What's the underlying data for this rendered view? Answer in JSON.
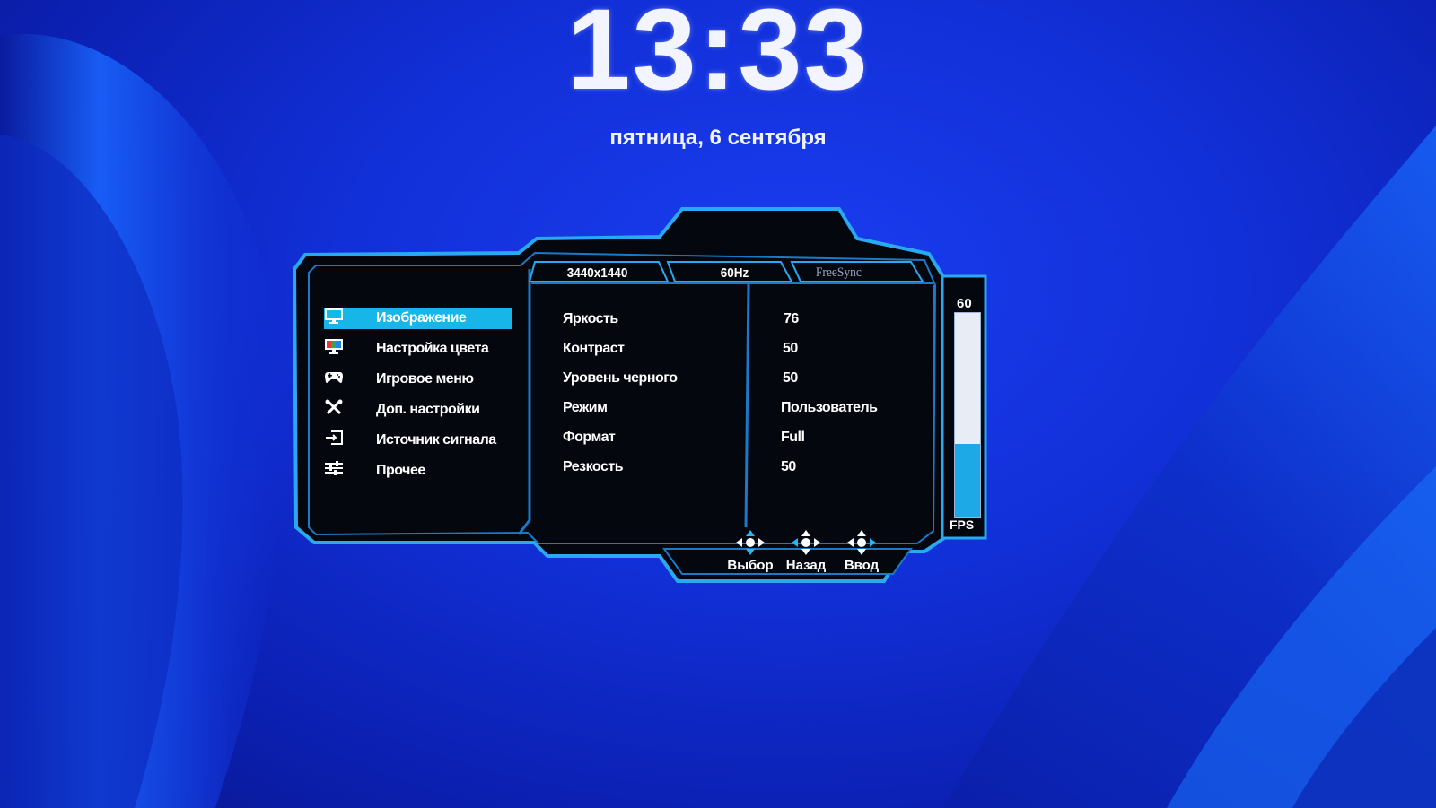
{
  "lockscreen": {
    "time": "13:33",
    "date": "пятница, 6 сентября"
  },
  "osd": {
    "tabs": [
      {
        "label": "3440x1440"
      },
      {
        "label": "60Hz"
      },
      {
        "label": "FreeSync"
      }
    ],
    "menu": [
      {
        "label": "Изображение",
        "icon": "monitor-icon",
        "active": true
      },
      {
        "label": "Настройка цвета",
        "icon": "color-bars-icon",
        "active": false
      },
      {
        "label": "Игровое меню",
        "icon": "gamepad-icon",
        "active": false
      },
      {
        "label": "Доп. настройки",
        "icon": "tools-icon",
        "active": false
      },
      {
        "label": "Источник сигнала",
        "icon": "input-source-icon",
        "active": false
      },
      {
        "label": "Прочее",
        "icon": "sliders-icon",
        "active": false
      }
    ],
    "settings": [
      {
        "label": "Яркость",
        "value": "76"
      },
      {
        "label": "Контраст",
        "value": "50"
      },
      {
        "label": "Уровень черного",
        "value": "50"
      },
      {
        "label": "Режим",
        "value": "Пользователь"
      },
      {
        "label": "Формат",
        "value": "Full"
      },
      {
        "label": "Резкость",
        "value": "50"
      }
    ],
    "fps": {
      "value": "60",
      "label": "FPS",
      "fill_fraction": 0.36
    },
    "hints": [
      {
        "label": "Выбор",
        "icon": "dpad-select-icon"
      },
      {
        "label": "Назад",
        "icon": "dpad-back-icon"
      },
      {
        "label": "Ввод",
        "icon": "dpad-enter-icon"
      }
    ],
    "colors": {
      "accent": "#18b6e8",
      "frame": "#2aa8f0",
      "panel": "#05070f"
    }
  }
}
